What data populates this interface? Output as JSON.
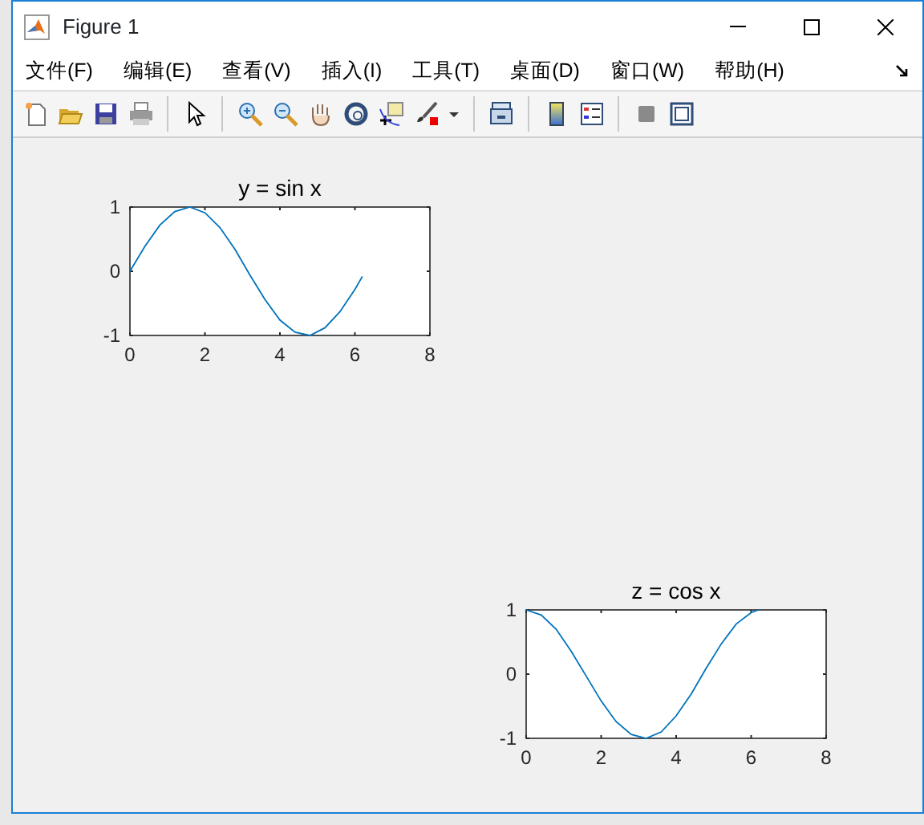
{
  "window": {
    "title": "Figure 1"
  },
  "menu": [
    "文件(F)",
    "编辑(E)",
    "查看(V)",
    "插入(I)",
    "工具(T)",
    "桌面(D)",
    "窗口(W)",
    "帮助(H)"
  ],
  "axes": [
    {
      "chart_data": {
        "type": "line",
        "title": "y = sin x",
        "xlim": [
          0,
          8
        ],
        "ylim": [
          -1,
          1
        ],
        "xticks": [
          0,
          2,
          4,
          6,
          8
        ],
        "yticks": [
          -1,
          0,
          1
        ],
        "x": [
          0,
          0.4,
          0.8,
          1.2,
          1.6,
          2.0,
          2.4,
          2.8,
          3.2,
          3.6,
          4.0,
          4.4,
          4.8,
          5.2,
          5.6,
          6.0,
          6.2
        ],
        "series": [
          {
            "color": "#0072bd",
            "values": [
              0,
              0.39,
              0.72,
              0.93,
              1.0,
              0.91,
              0.68,
              0.34,
              -0.06,
              -0.44,
              -0.76,
              -0.95,
              -1.0,
              -0.88,
              -0.63,
              -0.28,
              -0.08
            ]
          }
        ]
      }
    },
    {
      "chart_data": {
        "type": "line",
        "title": "z = cos x",
        "xlim": [
          0,
          8
        ],
        "ylim": [
          -1,
          1
        ],
        "xticks": [
          0,
          2,
          4,
          6,
          8
        ],
        "yticks": [
          -1,
          0,
          1
        ],
        "x": [
          0,
          0.4,
          0.8,
          1.2,
          1.6,
          2.0,
          2.4,
          2.8,
          3.2,
          3.6,
          4.0,
          4.4,
          4.8,
          5.2,
          5.6,
          6.0,
          6.2
        ],
        "series": [
          {
            "color": "#0072bd",
            "values": [
              1,
              0.92,
              0.7,
              0.36,
              -0.03,
              -0.42,
              -0.74,
              -0.94,
              -1.0,
              -0.9,
              -0.65,
              -0.31,
              0.09,
              0.47,
              0.78,
              0.96,
              1.0
            ]
          }
        ]
      }
    }
  ]
}
